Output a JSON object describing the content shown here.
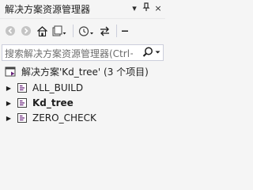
{
  "titlebar": {
    "title": "解决方案资源管理器",
    "dropdown_icon": "▾",
    "pin_icon": "ᵖ",
    "close_icon": "×"
  },
  "toolbar": {
    "pending_changes_icon": "⟲"
  },
  "search": {
    "placeholder": "搜索解决方案资源管理器(Ctrl+;)"
  },
  "tree": {
    "solution_label": "解决方案'Kd_tree' (3 个项目)",
    "projects": [
      {
        "label": "ALL_BUILD",
        "bold": false
      },
      {
        "label": "Kd_tree",
        "bold": true
      },
      {
        "label": "ZERO_CHECK",
        "bold": false
      }
    ]
  },
  "colors": {
    "background": "#f5f5f5",
    "accent": "#68217a",
    "icon_blue": "#1f5fa8"
  }
}
